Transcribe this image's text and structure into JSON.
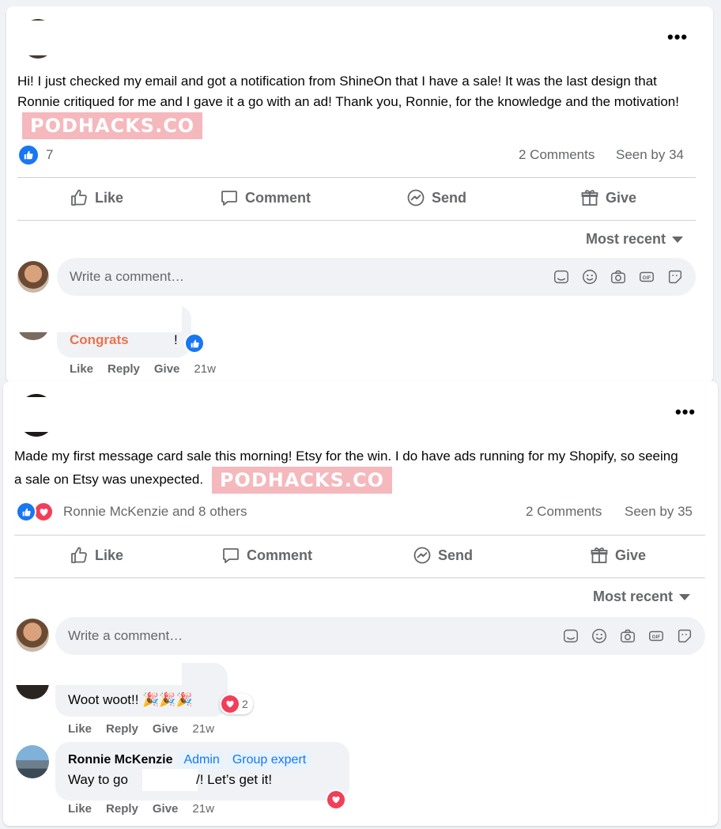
{
  "post1": {
    "text": "Hi! I just checked my email and got a notification from ShineOn that I have a sale! It was the last design that Ronnie critiqued for me and I gave it a go with an ad! Thank you, Ronnie, for the knowledge and the motivation!",
    "watermark": "PODHACKS.CO",
    "reaction_count": "7",
    "comments_count": "2 Comments",
    "seen_by": "Seen by 34",
    "actions": {
      "like": "Like",
      "comment": "Comment",
      "send": "Send",
      "give": "Give"
    },
    "sort_label": "Most recent",
    "comment_placeholder": "Write a comment…",
    "comment": {
      "text": "Congrats",
      "text_suffix": "!",
      "like": "Like",
      "reply": "Reply",
      "give": "Give",
      "time": "21w"
    }
  },
  "post2": {
    "text": "Made my first message card sale this morning! Etsy for the win. I do have ads running for my Shopify, so seeing a sale on Etsy was unexpected.",
    "watermark": "PODHACKS.CO",
    "reactors": "Ronnie McKenzie and 8 others",
    "comments_count": "2 Comments",
    "seen_by": "Seen by 35",
    "actions": {
      "like": "Like",
      "comment": "Comment",
      "send": "Send",
      "give": "Give"
    },
    "sort_label": "Most recent",
    "comment_placeholder": "Write a comment…",
    "comment1": {
      "text": "Woot woot!! 🎉🎉🎉",
      "reaction_count": "2",
      "like": "Like",
      "reply": "Reply",
      "give": "Give",
      "time": "21w"
    },
    "comment2": {
      "author": "Ronnie McKenzie",
      "badge_admin": "Admin",
      "badge_expert": "Group expert",
      "text_start": "Way to go",
      "text_end": "/! Let’s get it!",
      "like": "Like",
      "reply": "Reply",
      "give": "Give",
      "time": "21w"
    }
  },
  "colors": {
    "facebook_blue": "#1877f2",
    "love_red": "#f33e58",
    "muted": "#65676b",
    "congrats_orange": "#e8734f",
    "watermark_pink": "#f4b8bd"
  },
  "icons": [
    "like-icon",
    "comment-icon",
    "messenger-icon",
    "gift-icon",
    "sticker-icon",
    "emoji-icon",
    "camera-icon",
    "gif-icon",
    "avatar-sticker-icon",
    "more-icon",
    "love-icon",
    "caret-down-icon"
  ]
}
